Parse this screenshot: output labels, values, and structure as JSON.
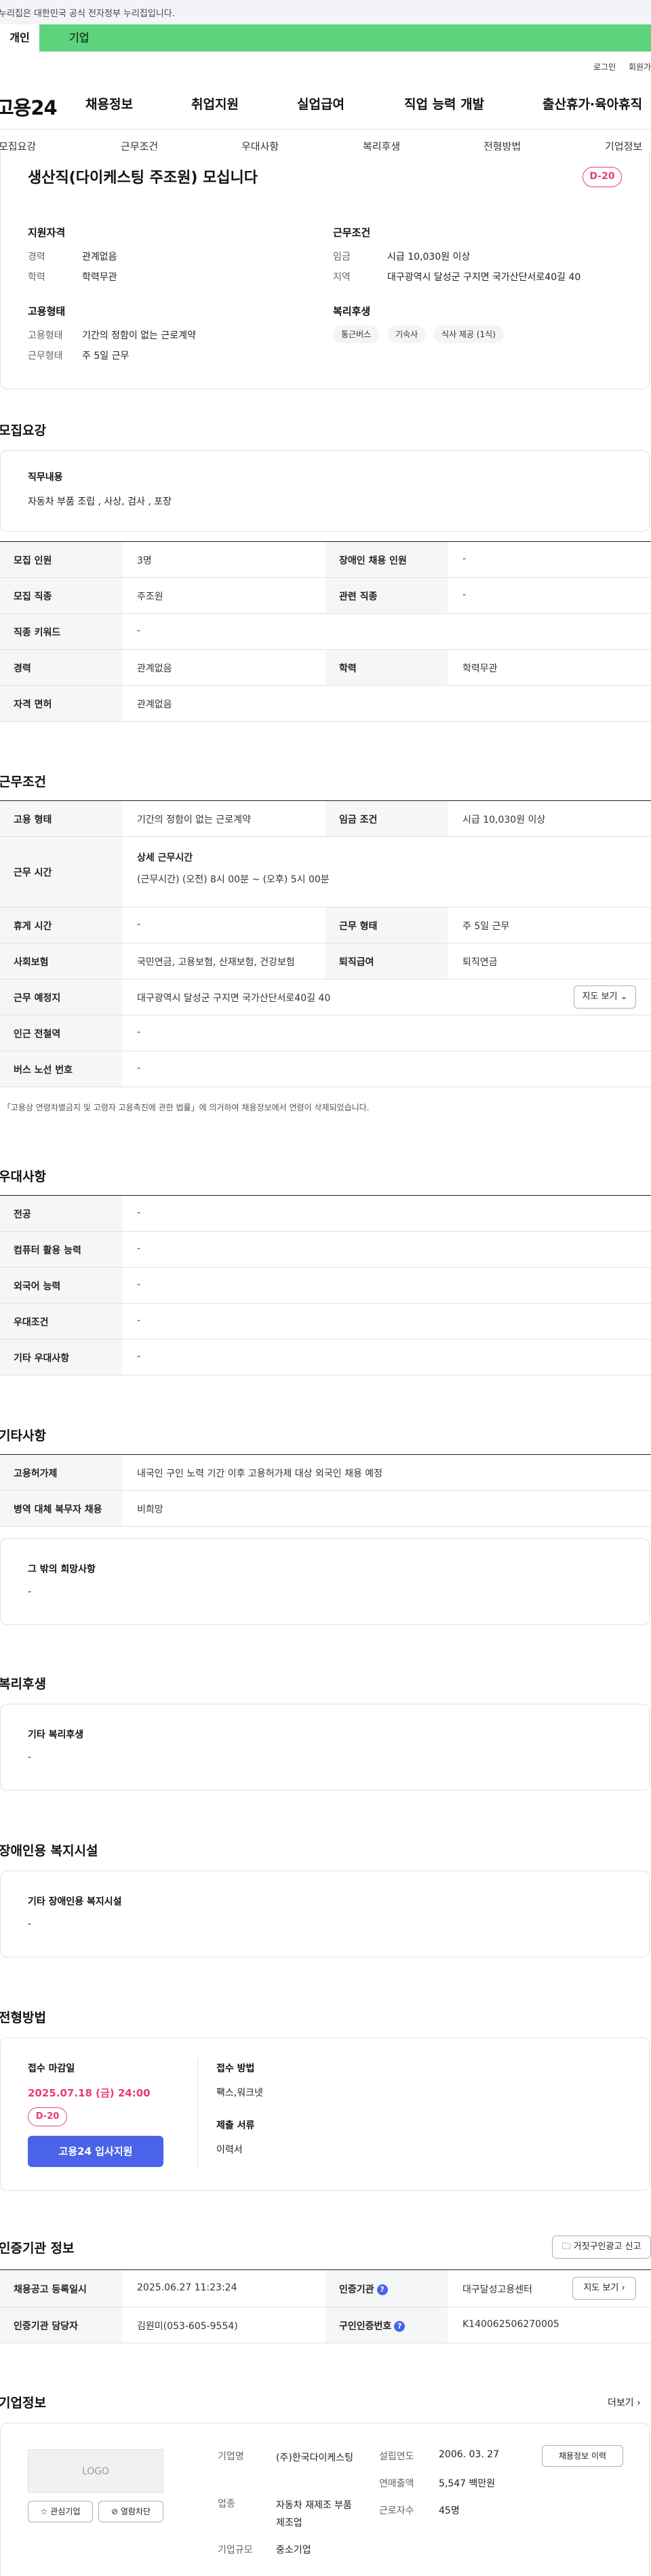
{
  "gov_banner": "누리집은 대한민국 공식 전자정부 누리집입니다.",
  "user_tabs": {
    "personal": "개인",
    "company": "기업"
  },
  "util_links": {
    "login": "로그인",
    "signup": "회원가입"
  },
  "logo": "고용24",
  "gnb": [
    "채용정보",
    "취업지원",
    "실업급여",
    "직업 능력 개발",
    "출산휴가·육아휴직"
  ],
  "anchor_nav": [
    "모집요강",
    "근무조건",
    "우대사항",
    "복리후생",
    "전형방법",
    "기업정보"
  ],
  "job_title": "생산직(다이케스팅 주조원) 모십니다",
  "d_day": "D-20",
  "summary": {
    "qualification": {
      "title": "지원자격",
      "rows": [
        {
          "label": "경력",
          "value": "관계없음"
        },
        {
          "label": "학력",
          "value": "학력무관"
        }
      ]
    },
    "conditions": {
      "title": "근무조건",
      "rows": [
        {
          "label": "임금",
          "value": "시급 10,030원 이상"
        },
        {
          "label": "지역",
          "value": "대구광역시 달성군 구지면 국가산단서로40길 40"
        }
      ]
    },
    "employment": {
      "title": "고용형태",
      "rows": [
        {
          "label": "고용형태",
          "value": "기간의 정함이 없는 근로계약"
        },
        {
          "label": "근무형태",
          "value": "주 5일 근무"
        }
      ]
    },
    "welfare": {
      "title": "복리후생",
      "chips": [
        "통근버스",
        "기숙사",
        "식사 제공 (1식)"
      ]
    }
  },
  "recruit": {
    "title": "모집요강",
    "duty_label": "직무내용",
    "duty_value": "자동차 부품  조립 , 사상, 검사 , 포장",
    "rows": [
      [
        {
          "label": "모집 인원",
          "value": "3명"
        },
        {
          "label": "장애인 채용 인원",
          "value": "-"
        }
      ],
      [
        {
          "label": "모집 직종",
          "value": "주조원"
        },
        {
          "label": "관련 직종",
          "value": "-"
        }
      ],
      [
        {
          "label": "직종 키워드",
          "value": "-"
        }
      ],
      [
        {
          "label": "경력",
          "value": "관계없음"
        },
        {
          "label": "학력",
          "value": "학력무관"
        }
      ],
      [
        {
          "label": "자격 면허",
          "value": "관계없음"
        }
      ]
    ]
  },
  "work": {
    "title": "근무조건",
    "employment_type": {
      "label": "고용 형태",
      "value": "기간의 정함이 없는 근로계약"
    },
    "wage": {
      "label": "임금 조건",
      "value": "시급 10,030원 이상"
    },
    "hours": {
      "label": "근무 시간",
      "sub_title": "상세 근무시간",
      "value": "(근무시간) (오전) 8시 00분 ~ (오후) 5시 00분"
    },
    "rest": {
      "label": "휴게 시간",
      "value": "-"
    },
    "work_form": {
      "label": "근무 형태",
      "value": "주 5일 근무"
    },
    "insurance": {
      "label": "사회보험",
      "value": "국민연금, 고용보험, 산재보험, 건강보험"
    },
    "retirement": {
      "label": "퇴직급여",
      "value": "퇴직연금"
    },
    "location": {
      "label": "근무 예정지",
      "value": "대구광역시 달성군 구지면 국가산단서로40길 40",
      "button": "지도 보기"
    },
    "subway": {
      "label": "인근 전철역",
      "value": "-"
    },
    "bus": {
      "label": "버스 노선 번호",
      "value": "-"
    },
    "note": "* 「고용상 연령차별금지 및 고령자 고용촉진에 관한 법률」에 의거하여 채용정보에서 연령이 삭제되었습니다."
  },
  "preference": {
    "title": "우대사항",
    "rows": [
      {
        "label": "전공",
        "value": "-"
      },
      {
        "label": "컴퓨터 활용 능력",
        "value": "-"
      },
      {
        "label": "외국어 능력",
        "value": "-"
      },
      {
        "label": "우대조건",
        "value": "-"
      },
      {
        "label": "기타 우대사항",
        "value": "-"
      }
    ]
  },
  "other": {
    "title": "기타사항",
    "rows": [
      {
        "label": "고용허가제",
        "value": "내국인 구인 노력 기간 이후 고용허가제 대상 외국인 채용 예정"
      },
      {
        "label": "병역 대체 복무자 채용",
        "value": "비희망"
      }
    ],
    "card_title": "그 밖의 희망사항",
    "card_value": "-"
  },
  "benefits": {
    "title": "복리후생",
    "card_title": "기타 복리후생",
    "card_value": "-"
  },
  "disability": {
    "title": "장애인용 복지시설",
    "card_title": "기타 장애인용 복지시설",
    "card_value": "-"
  },
  "selection": {
    "title": "전형방법",
    "deadline_label": "접수 마감일",
    "deadline_value": "2025.07.18 (금) 24:00",
    "d_day": "D-20",
    "apply_button": "고용24 입사지원",
    "method_label": "접수 방법",
    "method_value": "팩스,워크넷",
    "docs_label": "제출 서류",
    "docs_value": "이력서"
  },
  "cert": {
    "title": "인증기관 정보",
    "report_button": "거짓구인광고 신고",
    "rows": [
      [
        {
          "label": "채용공고 등록일시",
          "value": "2025.06.27 11:23:24"
        },
        {
          "label": "인증기관",
          "value": "대구달성고용센터",
          "button": "지도 보기"
        }
      ],
      [
        {
          "label": "인증기관 담당자",
          "value": "김원미(053-605-9554)"
        },
        {
          "label": "구인인증번호",
          "value": "K140062506270005"
        }
      ]
    ]
  },
  "company": {
    "title": "기업정보",
    "more": "더보기",
    "logo_text": "LOGO",
    "fav_button": "관심기업",
    "block_button": "열람차단",
    "history_button": "채용정보 이력",
    "name_label": "기업명",
    "name_value": "(주)한국다이케스팅",
    "industry_label": "업종",
    "industry_value": "자동차 재제조 부품 제조업",
    "size_label": "기업규모",
    "size_value": "중소기업",
    "founded_label": "설립연도",
    "founded_value": "2006. 03. 27",
    "sales_label": "연매출액",
    "sales_value": "5,547 백만원",
    "employees_label": "근로자수",
    "employees_value": "45명"
  }
}
